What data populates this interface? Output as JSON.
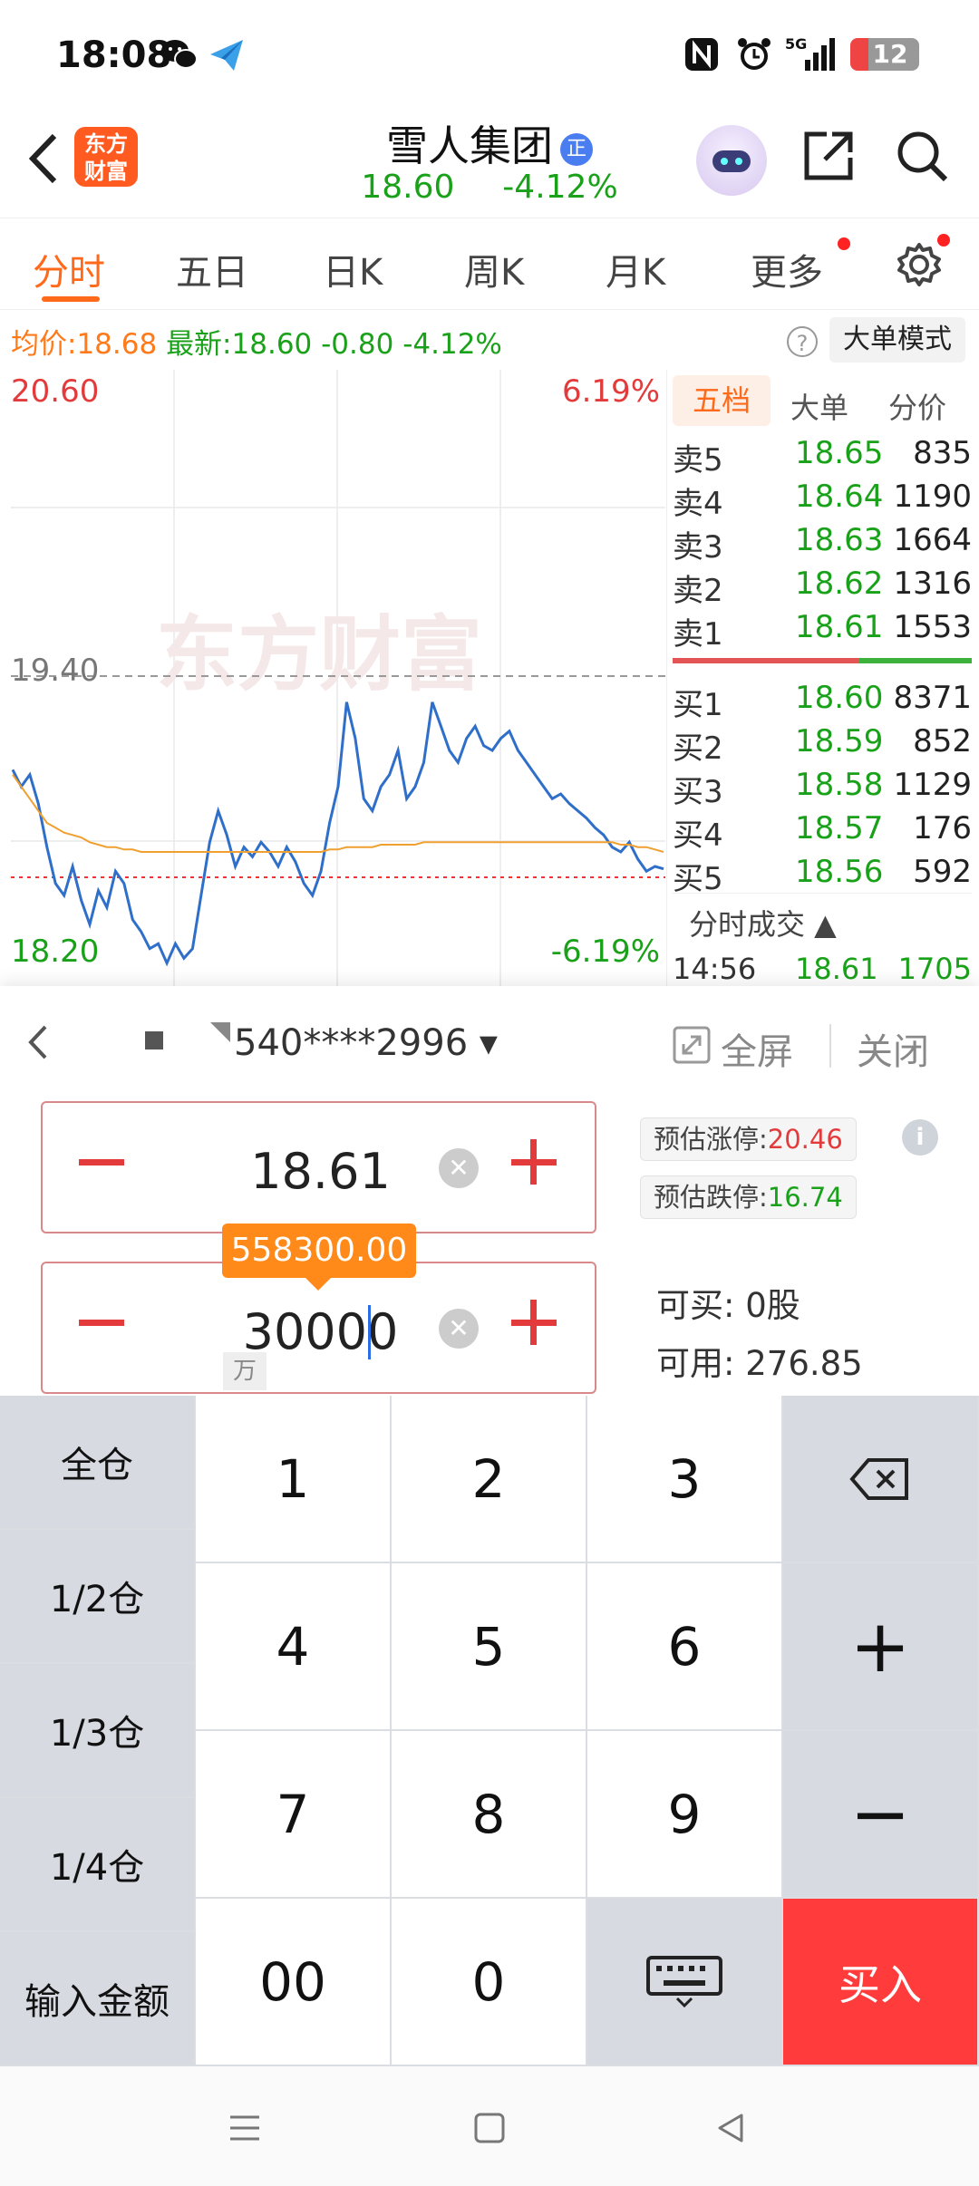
{
  "status_bar": {
    "time": "18:08",
    "battery": "12",
    "network": "5G"
  },
  "header": {
    "app_logo_text": "东方\n财富",
    "stock_name": "雪人集团",
    "badge": "正",
    "price": "18.60",
    "change_pct": "-4.12%"
  },
  "tabs": [
    {
      "label": "分时",
      "active": true
    },
    {
      "label": "五日"
    },
    {
      "label": "日K"
    },
    {
      "label": "周K"
    },
    {
      "label": "月K"
    },
    {
      "label": "更多"
    }
  ],
  "info_row": {
    "avg_label": "均价:",
    "avg_value": "18.68",
    "latest_label": "最新:",
    "latest_value": "18.60",
    "change": "-0.80",
    "change_pct": "-4.12%",
    "help": "?",
    "big_order_mode": "大单模式"
  },
  "chart": {
    "top_price": "20.60",
    "top_pct": "6.19%",
    "mid_price": "19.40",
    "bottom_price": "18.20",
    "bottom_pct": "-6.19%",
    "watermark": "东方财富"
  },
  "chart_data": {
    "type": "line",
    "ylim": [
      18.2,
      20.6
    ],
    "reference": 19.4,
    "series": [
      {
        "values": [
          19.02,
          18.95,
          19.0,
          18.88,
          18.7,
          18.55,
          18.5,
          18.62,
          18.48,
          18.38,
          18.52,
          18.45,
          18.6,
          18.55,
          18.4,
          18.35,
          18.28,
          18.3,
          18.22,
          18.3,
          18.24,
          18.28,
          18.5,
          18.72,
          18.85,
          18.75,
          18.62,
          18.7,
          18.66,
          18.72,
          18.68,
          18.62,
          18.7,
          18.64,
          18.55,
          18.5,
          18.6,
          18.8,
          18.95,
          19.3,
          19.15,
          18.9,
          18.85,
          18.95,
          19.0,
          19.1,
          18.9,
          18.95,
          19.05,
          19.3,
          19.2,
          19.1,
          19.05,
          19.15,
          19.2,
          19.12,
          19.1,
          19.15,
          19.18,
          19.1,
          19.05,
          19.0,
          18.95,
          18.9,
          18.92,
          18.88,
          18.85,
          18.82,
          18.78,
          18.75,
          18.7,
          18.68,
          18.72,
          18.65,
          18.6,
          18.62,
          18.61
        ]
      },
      {
        "values": [
          19.0,
          18.95,
          18.9,
          18.85,
          18.8,
          18.78,
          18.76,
          18.75,
          18.74,
          18.72,
          18.71,
          18.7,
          18.7,
          18.69,
          18.69,
          18.68,
          18.68,
          18.68,
          18.68,
          18.68,
          18.68,
          18.68,
          18.68,
          18.68,
          18.68,
          18.68,
          18.68,
          18.68,
          18.68,
          18.68,
          18.68,
          18.68,
          18.68,
          18.68,
          18.68,
          18.68,
          18.68,
          18.69,
          18.69,
          18.7,
          18.7,
          18.7,
          18.7,
          18.71,
          18.71,
          18.71,
          18.71,
          18.71,
          18.72,
          18.72,
          18.72,
          18.72,
          18.72,
          18.72,
          18.72,
          18.72,
          18.72,
          18.72,
          18.72,
          18.72,
          18.72,
          18.72,
          18.72,
          18.72,
          18.72,
          18.72,
          18.72,
          18.72,
          18.72,
          18.72,
          18.72,
          18.71,
          18.71,
          18.7,
          18.7,
          18.69,
          18.68
        ]
      }
    ]
  },
  "orderbook": {
    "tabs": [
      "五档",
      "大单",
      "分价"
    ],
    "asks": [
      {
        "label": "卖5",
        "price": "18.65",
        "vol": "835"
      },
      {
        "label": "卖4",
        "price": "18.64",
        "vol": "1190"
      },
      {
        "label": "卖3",
        "price": "18.63",
        "vol": "1664"
      },
      {
        "label": "卖2",
        "price": "18.62",
        "vol": "1316"
      },
      {
        "label": "卖1",
        "price": "18.61",
        "vol": "1553"
      }
    ],
    "bids": [
      {
        "label": "买1",
        "price": "18.60",
        "vol": "8371"
      },
      {
        "label": "买2",
        "price": "18.59",
        "vol": "852"
      },
      {
        "label": "买3",
        "price": "18.58",
        "vol": "1129"
      },
      {
        "label": "买4",
        "price": "18.57",
        "vol": "176"
      },
      {
        "label": "买5",
        "price": "18.56",
        "vol": "592"
      }
    ],
    "ticks_title": "分时成交 ▲",
    "tick": {
      "time": "14:56",
      "price": "18.61",
      "vol": "1705"
    }
  },
  "trade": {
    "account": "540****2996 ▾",
    "fullscreen": "全屏",
    "close": "关闭",
    "price_value": "18.61",
    "qty_value": "30000",
    "amount_tip": "558300.00",
    "wan": "万",
    "limit_up_label": "预估涨停:",
    "limit_up_value": "20.46",
    "limit_down_label": "预估跌停:",
    "limit_down_value": "16.74",
    "can_buy_label": "可买:",
    "can_buy_value": "0股",
    "can_use_label": "可用:",
    "can_use_value": "276.85",
    "info": "i"
  },
  "keypad": {
    "side": [
      "全仓",
      "1/2仓",
      "1/3仓",
      "1/4仓",
      "输入金额"
    ],
    "digits": [
      "1",
      "2",
      "3",
      "4",
      "5",
      "6",
      "7",
      "8",
      "9",
      "00",
      "0"
    ],
    "plus": "+",
    "minus": "−",
    "buy": "买入"
  }
}
